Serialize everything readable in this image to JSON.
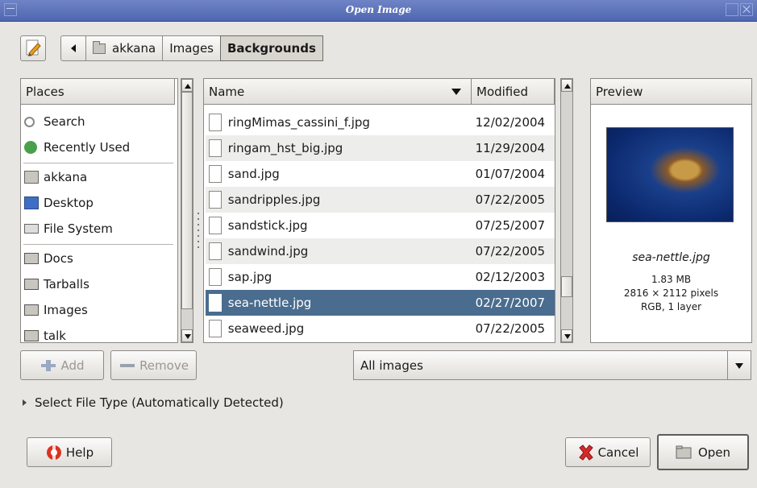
{
  "window": {
    "title": "Open Image"
  },
  "pathbar": {
    "crumbs": [
      "akkana",
      "Images",
      "Backgrounds"
    ]
  },
  "places": {
    "header": "Places",
    "items": [
      {
        "label": "Search",
        "icon": "search-icon"
      },
      {
        "label": "Recently Used",
        "icon": "recently-used-icon"
      },
      {
        "label": "akkana",
        "icon": "home-folder-icon"
      },
      {
        "label": "Desktop",
        "icon": "desktop-icon"
      },
      {
        "label": "File System",
        "icon": "filesystem-icon"
      },
      {
        "label": "Docs",
        "icon": "folder-icon"
      },
      {
        "label": "Tarballs",
        "icon": "folder-icon"
      },
      {
        "label": "Images",
        "icon": "folder-icon"
      },
      {
        "label": "talk",
        "icon": "folder-icon"
      }
    ]
  },
  "files": {
    "headers": {
      "name": "Name",
      "modified": "Modified"
    },
    "rows": [
      {
        "name": "ringMimas_cassini_f.jpg",
        "modified": "12/02/2004"
      },
      {
        "name": "ringam_hst_big.jpg",
        "modified": "11/29/2004"
      },
      {
        "name": "sand.jpg",
        "modified": "01/07/2004"
      },
      {
        "name": "sandripples.jpg",
        "modified": "07/22/2005"
      },
      {
        "name": "sandstick.jpg",
        "modified": "07/25/2007"
      },
      {
        "name": "sandwind.jpg",
        "modified": "07/22/2005"
      },
      {
        "name": "sap.jpg",
        "modified": "02/12/2003"
      },
      {
        "name": "sea-nettle.jpg",
        "modified": "02/27/2007"
      },
      {
        "name": "seaweed.jpg",
        "modified": "07/22/2005"
      }
    ],
    "selected_index": 7
  },
  "preview": {
    "header": "Preview",
    "filename": "sea-nettle.jpg",
    "size": "1.83 MB",
    "dimensions": "2816 × 2112 pixels",
    "info": "RGB, 1 layer"
  },
  "buttons": {
    "add": "Add",
    "remove": "Remove",
    "help": "Help",
    "cancel": "Cancel",
    "open": "Open"
  },
  "filter": {
    "selected": "All images"
  },
  "file_type": {
    "label": "Select File Type (Automatically Detected)"
  },
  "colors": {
    "selection": "#4a6c8e",
    "titlebar": "#5a70b8"
  }
}
